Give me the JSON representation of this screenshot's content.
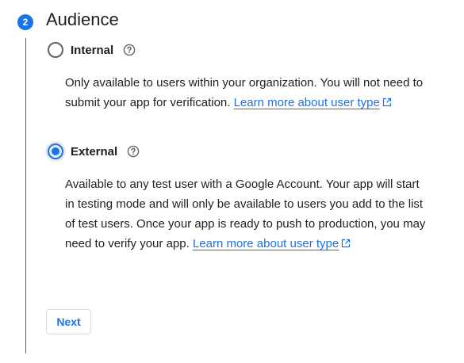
{
  "step": {
    "number": "2",
    "title": "Audience"
  },
  "options": [
    {
      "label": "Internal",
      "selected": false,
      "description": "Only available to users within your organization. You will not need to submit your app for verification. ",
      "link_text": "Learn more about user type"
    },
    {
      "label": "External",
      "selected": true,
      "description": "Available to any test user with a Google Account. Your app will start in testing mode and will only be available to users you add to the list of test users. Once your app is ready to push to production, you may need to verify your app. ",
      "link_text": "Learn more about user type"
    }
  ],
  "next_button": {
    "label": "Next"
  },
  "colors": {
    "accent": "#1a73e8",
    "text": "#202124",
    "icon": "#5f6368"
  },
  "icons": [
    "help-outline-icon",
    "open-in-new-icon"
  ]
}
